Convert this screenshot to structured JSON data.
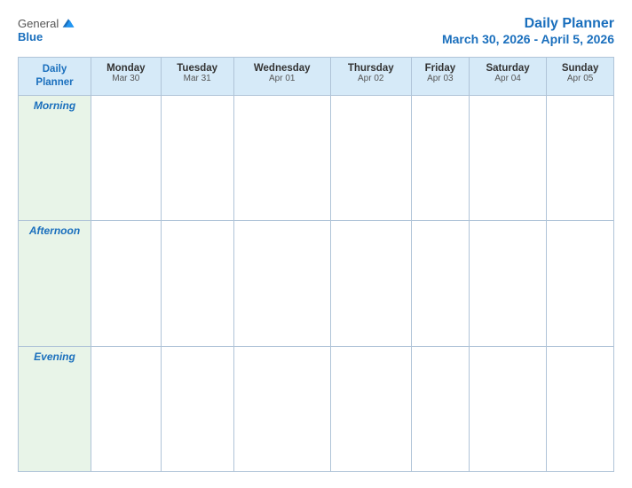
{
  "logo": {
    "general": "General",
    "blue": "Blue"
  },
  "header": {
    "title": "Daily Planner",
    "dates": "March 30, 2026 - April 5, 2026"
  },
  "table": {
    "header_col": {
      "line1": "Daily",
      "line2": "Planner"
    },
    "days": [
      {
        "name": "Monday",
        "date": "Mar 30"
      },
      {
        "name": "Tuesday",
        "date": "Mar 31"
      },
      {
        "name": "Wednesday",
        "date": "Apr 01"
      },
      {
        "name": "Thursday",
        "date": "Apr 02"
      },
      {
        "name": "Friday",
        "date": "Apr 03"
      },
      {
        "name": "Saturday",
        "date": "Apr 04"
      },
      {
        "name": "Sunday",
        "date": "Apr 05"
      }
    ],
    "time_slots": [
      "Morning",
      "Afternoon",
      "Evening"
    ]
  }
}
